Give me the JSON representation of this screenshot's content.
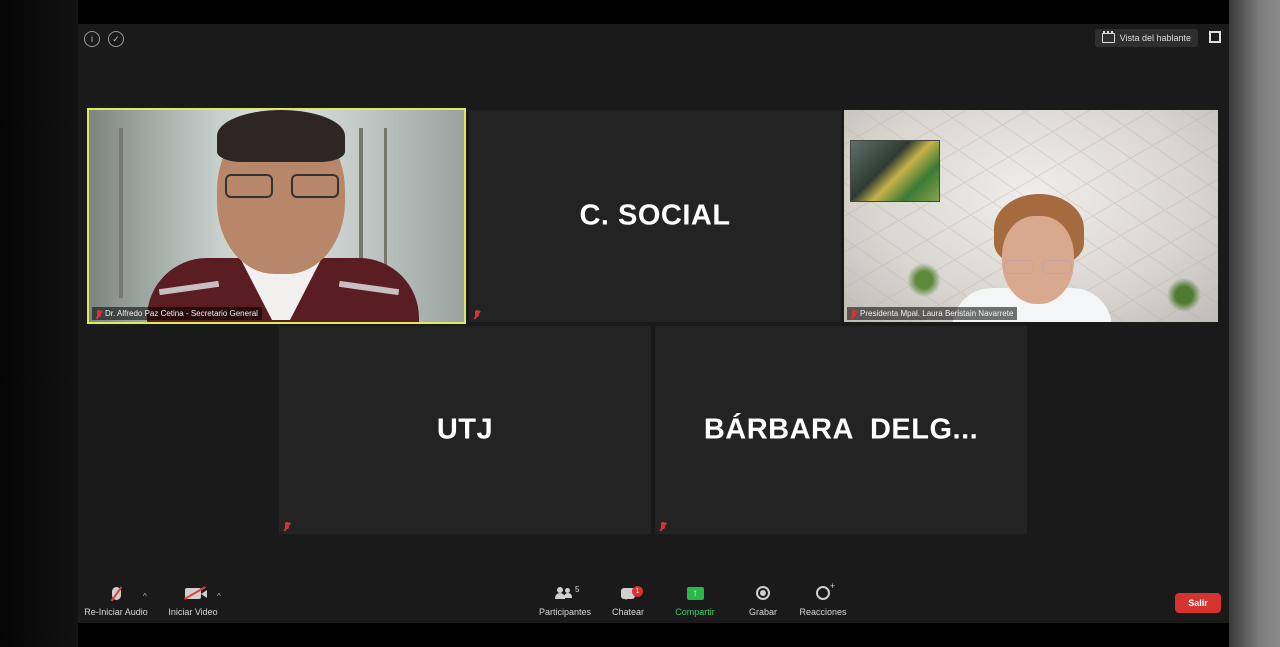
{
  "toolbar": {
    "info_icon": "info-icon",
    "security_icon": "shield-icon",
    "view_button_label": "Vista del hablante",
    "fullscreen_icon": "fullscreen-icon"
  },
  "participants": {
    "p1": {
      "label": "Dr. Alfredo Paz Cetina - Secretario General",
      "muted": true,
      "active_speaker": true
    },
    "p2": {
      "display_name": "C. SOCIAL",
      "muted": true
    },
    "p3": {
      "label": "Presidenta Mpal. Laura Beristain Navarrete",
      "muted": true
    },
    "p4": {
      "display_name": "UTJ",
      "muted": true
    },
    "p5": {
      "display_name": "BÁRBARA  DELG...",
      "muted": true
    }
  },
  "controls": {
    "audio_label": "Re-Iniciar Audio",
    "video_label": "Iniciar Video",
    "participants_label": "Participantes",
    "participants_count": "5",
    "chat_label": "Chatear",
    "chat_badge": "1",
    "share_label": "Compartir",
    "record_label": "Grabar",
    "reactions_label": "Reacciones",
    "leave_label": "Salir"
  },
  "colors": {
    "active_speaker_border": "#e1e85a",
    "share_green": "#28b84a",
    "leave_red": "#d6322f",
    "muted_red": "#d53535"
  }
}
